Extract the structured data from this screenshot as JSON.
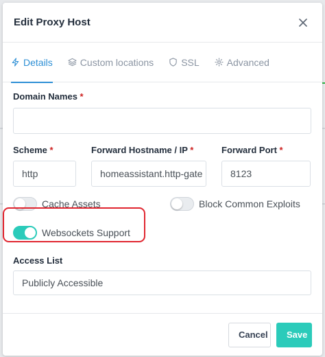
{
  "modal": {
    "title": "Edit Proxy Host"
  },
  "tabs": [
    {
      "label": "Details",
      "icon": "bolt-icon",
      "active": true
    },
    {
      "label": "Custom locations",
      "icon": "layers-icon",
      "active": false
    },
    {
      "label": "SSL",
      "icon": "shield-icon",
      "active": false
    },
    {
      "label": "Advanced",
      "icon": "gear-icon",
      "active": false
    }
  ],
  "form": {
    "domain_names": {
      "label": "Domain Names",
      "required_mark": "*",
      "value": ""
    },
    "scheme": {
      "label": "Scheme",
      "required_mark": "*",
      "value": "http"
    },
    "forward_hostname": {
      "label": "Forward Hostname / IP",
      "required_mark": "*",
      "value": "homeassistant.http-gate"
    },
    "forward_port": {
      "label": "Forward Port",
      "required_mark": "*",
      "value": "8123"
    },
    "cache_assets": {
      "label": "Cache Assets",
      "enabled": false
    },
    "block_exploits": {
      "label": "Block Common Exploits",
      "enabled": false
    },
    "websockets": {
      "label": "Websockets Support",
      "enabled": true
    },
    "access_list": {
      "label": "Access List",
      "value": "Publicly Accessible"
    }
  },
  "footer": {
    "cancel_label": "Cancel",
    "save_label": "Save"
  },
  "colors": {
    "accent": "#2bcbba",
    "tab_active": "#2d8fd5",
    "required": "#cd201f",
    "highlight": "#e0242e"
  }
}
